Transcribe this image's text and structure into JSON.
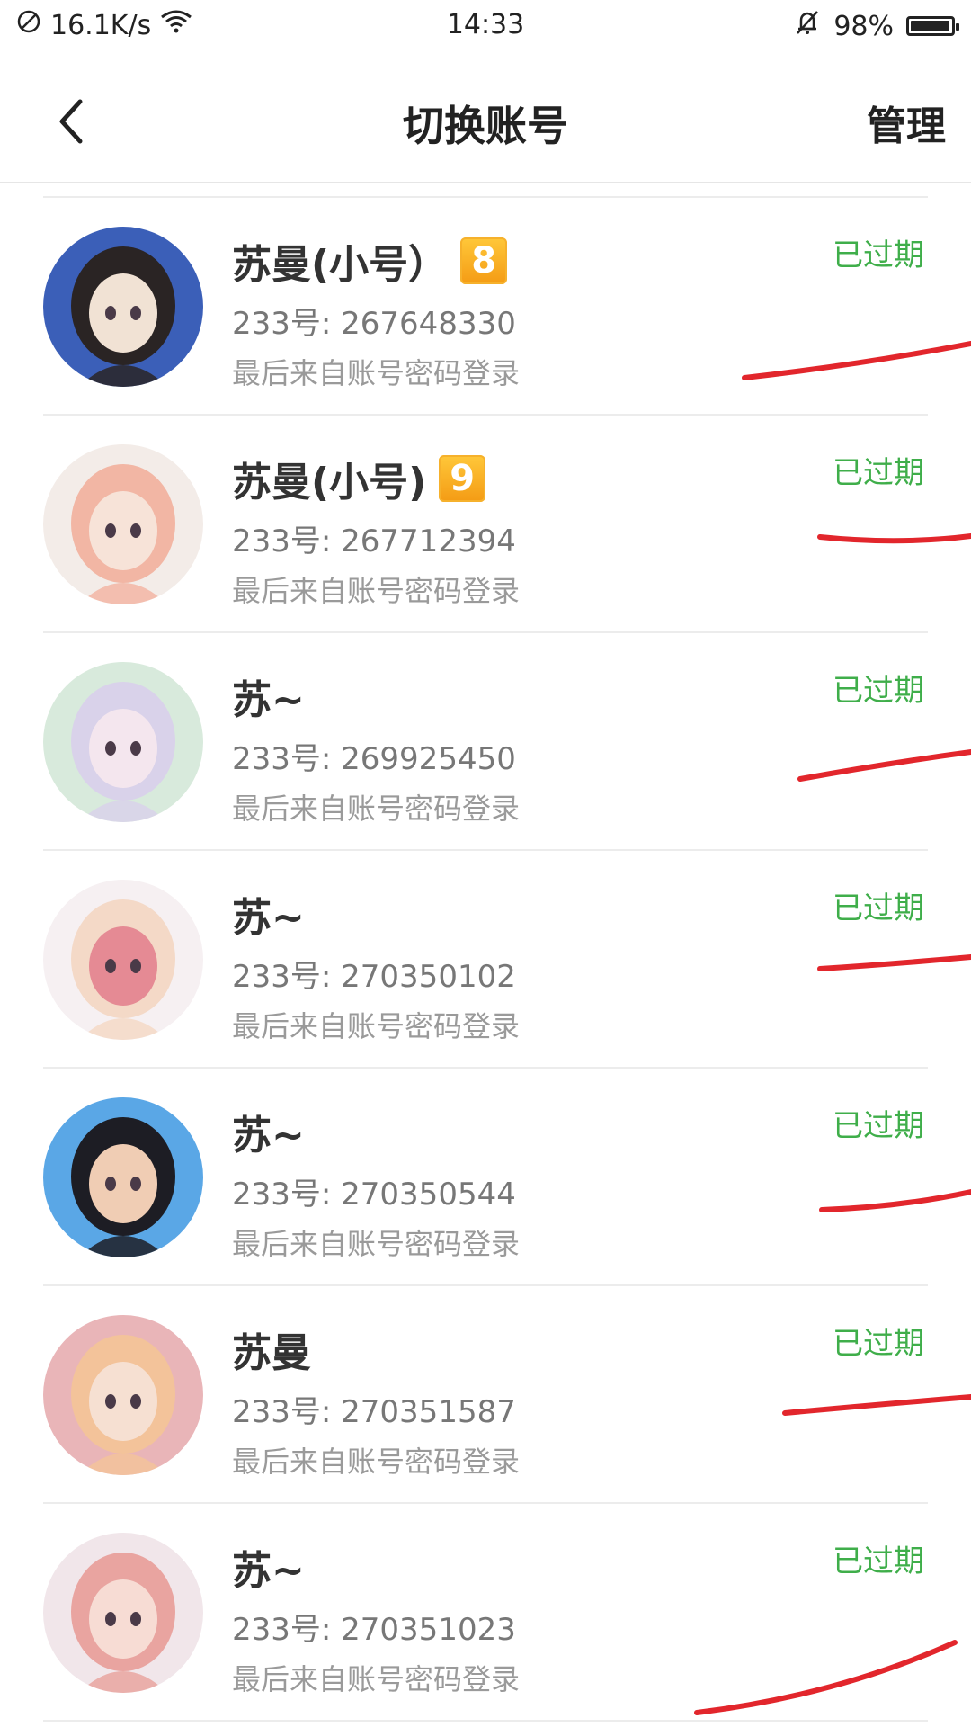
{
  "status_bar": {
    "net_speed": "16.1K/s",
    "time": "14:33",
    "battery": "98%",
    "battery_level": 0.98
  },
  "header": {
    "title": "切换账号",
    "manage": "管理"
  },
  "accounts": [
    {
      "name": "苏曼(小号）",
      "level": "8",
      "uid": "233号: 267648330",
      "login": "最后来自账号密码登录",
      "status": "已过期"
    },
    {
      "name": "苏曼(小号)",
      "level": "9",
      "uid": "233号: 267712394",
      "login": "最后来自账号密码登录",
      "status": "已过期"
    },
    {
      "name": "苏~",
      "uid": "233号: 269925450",
      "login": "最后来自账号密码登录",
      "status": "已过期"
    },
    {
      "name": "苏~",
      "uid": "233号: 270350102",
      "login": "最后来自账号密码登录",
      "status": "已过期"
    },
    {
      "name": "苏~",
      "uid": "233号: 270350544",
      "login": "最后来自账号密码登录",
      "status": "已过期"
    },
    {
      "name": "苏曼",
      "uid": "233号: 270351587",
      "login": "最后来自账号密码登录",
      "status": "已过期"
    },
    {
      "name": "苏~",
      "uid": "233号: 270351023",
      "login": "最后来自账号密码登录",
      "status": "已过期"
    }
  ],
  "colors": {
    "status_green": "#3fae4a",
    "scribble_red": "#e2262c",
    "badge_orange": "#f49b14"
  }
}
